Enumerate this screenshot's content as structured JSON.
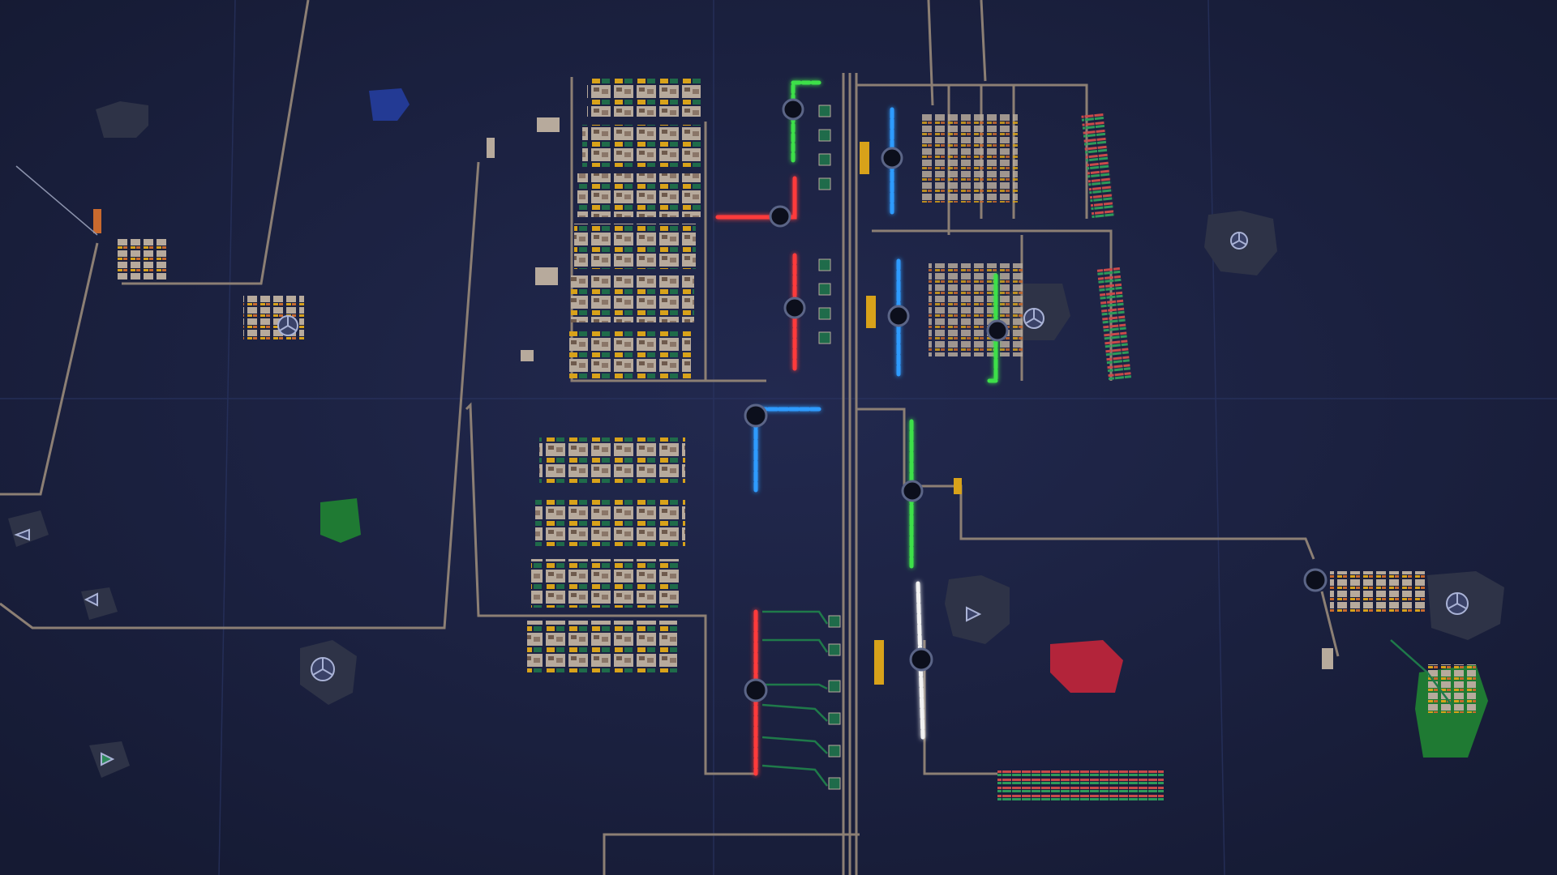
{
  "scene": {
    "kind": "top-down factory automation map",
    "text_visible": false,
    "background_color": "#1b2140",
    "grid_color": "#27305a",
    "belt_color": "#8c7f74",
    "colors": {
      "red_belt": "#ff3b3b",
      "green_belt": "#3ee04a",
      "blue_belt": "#2f9bff",
      "white_belt": "#f1f1f1",
      "ore_blue": "#233a94",
      "ore_green": "#1f7a33",
      "ore_red": "#b3243a",
      "resource_gray": "#2e3347",
      "building_beige": "#b7aa9c",
      "building_yellow": "#d8a21a",
      "building_orange": "#c96a2e"
    },
    "icons": [
      "hub-icon",
      "splitter-icon",
      "resource-node-icon",
      "storage-container-icon"
    ]
  }
}
